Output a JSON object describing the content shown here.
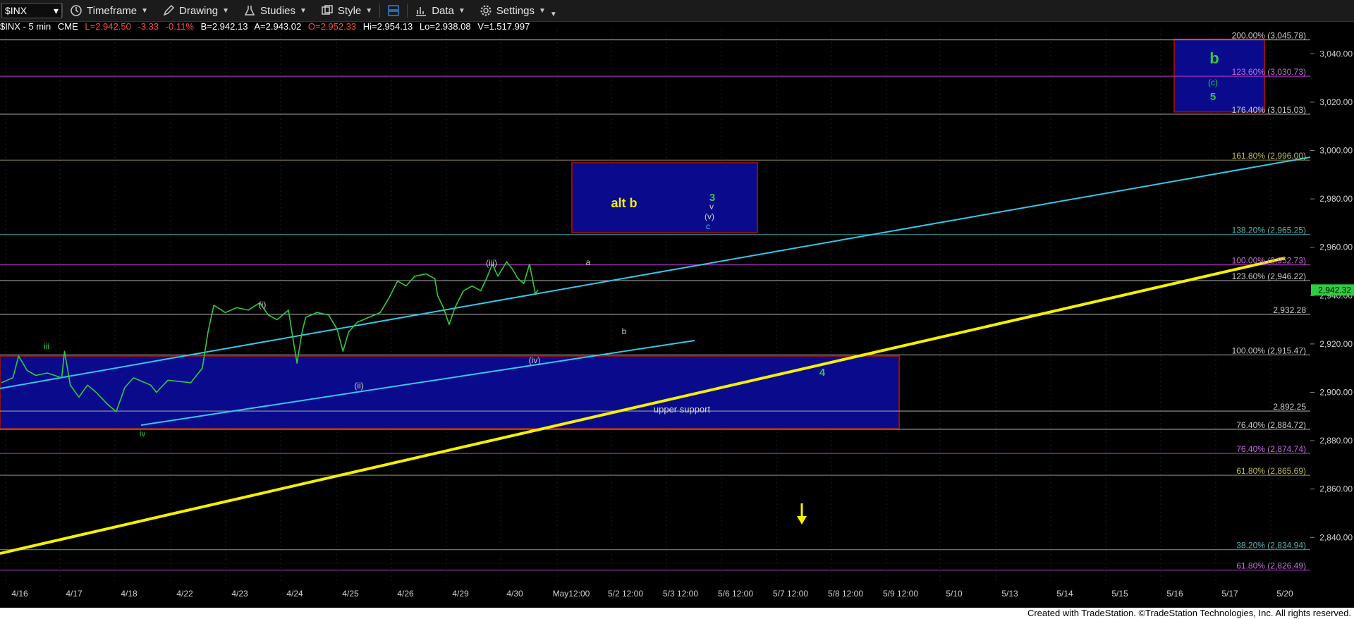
{
  "toolbar": {
    "symbol": "$INX",
    "timeframe": "Timeframe",
    "drawing": "Drawing",
    "studies": "Studies",
    "style": "Style",
    "data": "Data",
    "settings": "Settings"
  },
  "quote": {
    "name": "$INX - 5 min",
    "exchange": "CME",
    "last": "L=2,942.50",
    "change": "-3.33",
    "change_pct": "-0.11%",
    "bid": "B=2,942.13",
    "ask": "A=2,943.02",
    "open": "O=2,952.33",
    "high": "Hi=2,954.13",
    "low": "Lo=2,938.08",
    "volume": "V=1,517,997"
  },
  "footer": "Created with TradeStation. ©TradeStation Technologies, Inc. All rights reserved.",
  "colors": {
    "background": "#000000",
    "price_line": "#2ecc40",
    "channel": "#33c8e8",
    "trendline": "#f4f000",
    "box_fill": "#0a0a8c",
    "box_border": "#8b1010",
    "fib_gray": "#9a9a9a",
    "fib_purple": "#9b2fae",
    "fib_olive": "#7a7a3a"
  },
  "chart_data": {
    "type": "line",
    "ylim": [
      2822,
      3050
    ],
    "y_ticks": [
      "3,040.00",
      "3,020.00",
      "3,000.00",
      "2,980.00",
      "2,960.00",
      "2,940.00",
      "2,920.00",
      "2,900.00",
      "2,880.00",
      "2,860.00",
      "2,840.00"
    ],
    "y_tick_values": [
      3040,
      3020,
      3000,
      2980,
      2960,
      2940,
      2920,
      2900,
      2880,
      2860,
      2840
    ],
    "x_ticks": [
      "4/16",
      "4/17",
      "4/18",
      "4/22",
      "4/23",
      "4/24",
      "4/25",
      "4/26",
      "4/29",
      "4/30",
      "May12:00",
      "5/2 12:00",
      "5/3 12:00",
      "5/6 12:00",
      "5/7 12:00",
      "5/8 12:00",
      "5/9 12:00",
      "5/10",
      "5/13",
      "5/14",
      "5/15",
      "5/16",
      "5/17",
      "5/20"
    ],
    "last_price_label": "2,942.32",
    "series": [
      {
        "values": [
          {
            "t": 0,
            "y": 2904
          },
          {
            "t": 2,
            "y": 2906
          },
          {
            "t": 3,
            "y": 2915
          },
          {
            "t": 4.5,
            "y": 2909
          },
          {
            "t": 6,
            "y": 2907
          },
          {
            "t": 8,
            "y": 2908
          },
          {
            "t": 10.5,
            "y": 2906
          },
          {
            "t": 11,
            "y": 2917
          },
          {
            "t": 12,
            "y": 2903
          },
          {
            "t": 13.5,
            "y": 2898
          },
          {
            "t": 15,
            "y": 2903
          },
          {
            "t": 16.5,
            "y": 2900
          },
          {
            "t": 18.5,
            "y": 2895
          },
          {
            "t": 20,
            "y": 2892
          },
          {
            "t": 21.5,
            "y": 2902
          },
          {
            "t": 23,
            "y": 2906
          },
          {
            "t": 26,
            "y": 2903
          },
          {
            "t": 27,
            "y": 2900
          },
          {
            "t": 29,
            "y": 2905
          },
          {
            "t": 33,
            "y": 2904
          },
          {
            "t": 35,
            "y": 2910
          },
          {
            "t": 36,
            "y": 2925
          },
          {
            "t": 37,
            "y": 2936
          },
          {
            "t": 39,
            "y": 2933
          },
          {
            "t": 41,
            "y": 2935
          },
          {
            "t": 43,
            "y": 2934
          },
          {
            "t": 45,
            "y": 2937
          },
          {
            "t": 46.5,
            "y": 2932
          },
          {
            "t": 48,
            "y": 2930
          },
          {
            "t": 50,
            "y": 2934
          },
          {
            "t": 50.8,
            "y": 2922
          },
          {
            "t": 51.5,
            "y": 2912
          },
          {
            "t": 52.3,
            "y": 2924
          },
          {
            "t": 53,
            "y": 2931
          },
          {
            "t": 55,
            "y": 2933
          },
          {
            "t": 57,
            "y": 2932
          },
          {
            "t": 58.5,
            "y": 2926
          },
          {
            "t": 59.5,
            "y": 2917
          },
          {
            "t": 60.5,
            "y": 2925
          },
          {
            "t": 62,
            "y": 2929
          },
          {
            "t": 64,
            "y": 2931
          },
          {
            "t": 66,
            "y": 2933
          },
          {
            "t": 67.5,
            "y": 2939
          },
          {
            "t": 69,
            "y": 2946
          },
          {
            "t": 70.5,
            "y": 2944
          },
          {
            "t": 72,
            "y": 2948
          },
          {
            "t": 74,
            "y": 2949
          },
          {
            "t": 75.5,
            "y": 2947
          },
          {
            "t": 76,
            "y": 2940
          },
          {
            "t": 77,
            "y": 2935
          },
          {
            "t": 78,
            "y": 2928
          },
          {
            "t": 79,
            "y": 2935
          },
          {
            "t": 80.5,
            "y": 2942
          },
          {
            "t": 82,
            "y": 2944
          },
          {
            "t": 83.5,
            "y": 2942
          },
          {
            "t": 84.5,
            "y": 2947
          },
          {
            "t": 85.5,
            "y": 2953
          },
          {
            "t": 86.5,
            "y": 2948
          },
          {
            "t": 88,
            "y": 2954
          },
          {
            "t": 89,
            "y": 2951
          },
          {
            "t": 90,
            "y": 2947
          },
          {
            "t": 91,
            "y": 2945
          },
          {
            "t": 92,
            "y": 2953
          },
          {
            "t": 93,
            "y": 2941
          },
          {
            "t": 93.5,
            "y": 2942.3
          }
        ]
      }
    ],
    "fib_levels": [
      {
        "label": "200.00% (3,045.78)",
        "value": 3045.78,
        "color": "#9a9a9a"
      },
      {
        "label": "123.60% (3,030.73)",
        "value": 3030.73,
        "color": "#9b2fae"
      },
      {
        "label": "176.40% (3,015.03)",
        "value": 3015.03,
        "color": "#9a9a9a"
      },
      {
        "label": "161.80% (2,996.00)",
        "value": 2996.0,
        "color": "#7a7a3a"
      },
      {
        "label": "138.20% (2,965.25)",
        "value": 2965.25,
        "color": "#2f8a8a"
      },
      {
        "label": "100.00% (2,952.73)",
        "value": 2952.73,
        "color": "#9b2fae"
      },
      {
        "label": "123.60% (2,946.22)",
        "value": 2946.22,
        "color": "#9a9a9a"
      },
      {
        "label": "2,932.28",
        "value": 2932.28,
        "color": "#9a9a9a"
      },
      {
        "label": "100.00% (2,915.47)",
        "value": 2915.47,
        "color": "#9a9a9a"
      },
      {
        "label": "2,892.25",
        "value": 2892.25,
        "color": "#9a9a9a"
      },
      {
        "label": "76.40% (2,884.72)",
        "value": 2884.72,
        "color": "#9a9a9a"
      },
      {
        "label": "76.40% (2,874.74)",
        "value": 2874.74,
        "color": "#9b2fae"
      },
      {
        "label": "61.80% (2,865.69)",
        "value": 2865.69,
        "color": "#7a7a3a"
      },
      {
        "label": "38.20% (2,834.94)",
        "value": 2834.94,
        "color": "#2f8a8a"
      },
      {
        "label": "61.80% (2,826.49)",
        "value": 2826.49,
        "color": "#9b2fae"
      }
    ],
    "trendlines": [
      {
        "name": "upper-channel",
        "color": "#33c8e8",
        "from": {
          "t": -2,
          "y": 2918
        },
        "to": {
          "t": 239,
          "y": 3008
        }
      },
      {
        "name": "lower-channel",
        "color": "#33c8e8",
        "from": {
          "t": 21,
          "y": 2892
        },
        "to": {
          "t": 127,
          "y": 2938
        }
      },
      {
        "name": "yellow-trendline",
        "color": "#f4f000",
        "from": {
          "t": -2,
          "y": 2851
        },
        "to": {
          "t": 237,
          "y": 2971
        }
      }
    ],
    "boxes": [
      {
        "name": "upper-support",
        "label": "upper support",
        "t0": -2,
        "t1": 164,
        "y0": 2885,
        "y1": 2915
      },
      {
        "name": "alt-b-target",
        "label": "alt b",
        "t0": 104,
        "t1": 138,
        "y0": 2966,
        "y1": 2995
      },
      {
        "name": "b-target",
        "label": "b",
        "t0": 214,
        "t1": 231,
        "y0": 3016,
        "y1": 3046
      }
    ],
    "wave_labels": [
      {
        "text": "iii",
        "t": 8,
        "y": 2920,
        "color": "#2ecc40"
      },
      {
        "text": "iv",
        "t": 26,
        "y": 2887,
        "color": "#2ecc40"
      },
      {
        "text": "(i)",
        "t": 47.5,
        "y": 2941,
        "color": "#cccccc"
      },
      {
        "text": "(ii)",
        "t": 65.5,
        "y": 2909,
        "color": "#cccccc"
      },
      {
        "text": "(iii)",
        "t": 89.5,
        "y": 2956,
        "color": "#cccccc"
      },
      {
        "text": "(iv)",
        "t": 97.5,
        "y": 2919,
        "color": "#cccccc"
      },
      {
        "text": "a",
        "t": 107,
        "y": 2956,
        "color": "#cccccc"
      },
      {
        "text": "b",
        "t": 113.5,
        "y": 2927,
        "color": "#cccccc"
      },
      {
        "text": "3",
        "t": 129.5,
        "y": 2976,
        "color": "#2ecc40"
      },
      {
        "text": "v",
        "t": 129.5,
        "y": 2973,
        "color": "#cccccc"
      },
      {
        "text": "(v)",
        "t": 129.5,
        "y": 2969,
        "color": "#cccccc"
      },
      {
        "text": "c",
        "t": 129.5,
        "y": 2965,
        "color": "#33c8e8"
      },
      {
        "text": "4",
        "t": 150,
        "y": 2912,
        "color": "#2ecc40"
      },
      {
        "text": "(c)",
        "t": 221,
        "y": 3029,
        "color": "#2ecc40"
      },
      {
        "text": "5",
        "t": 221,
        "y": 3023,
        "color": "#2ecc40"
      }
    ],
    "arrow": {
      "t": 146,
      "y": 2854,
      "color": "#f4f000",
      "direction": "down"
    }
  }
}
